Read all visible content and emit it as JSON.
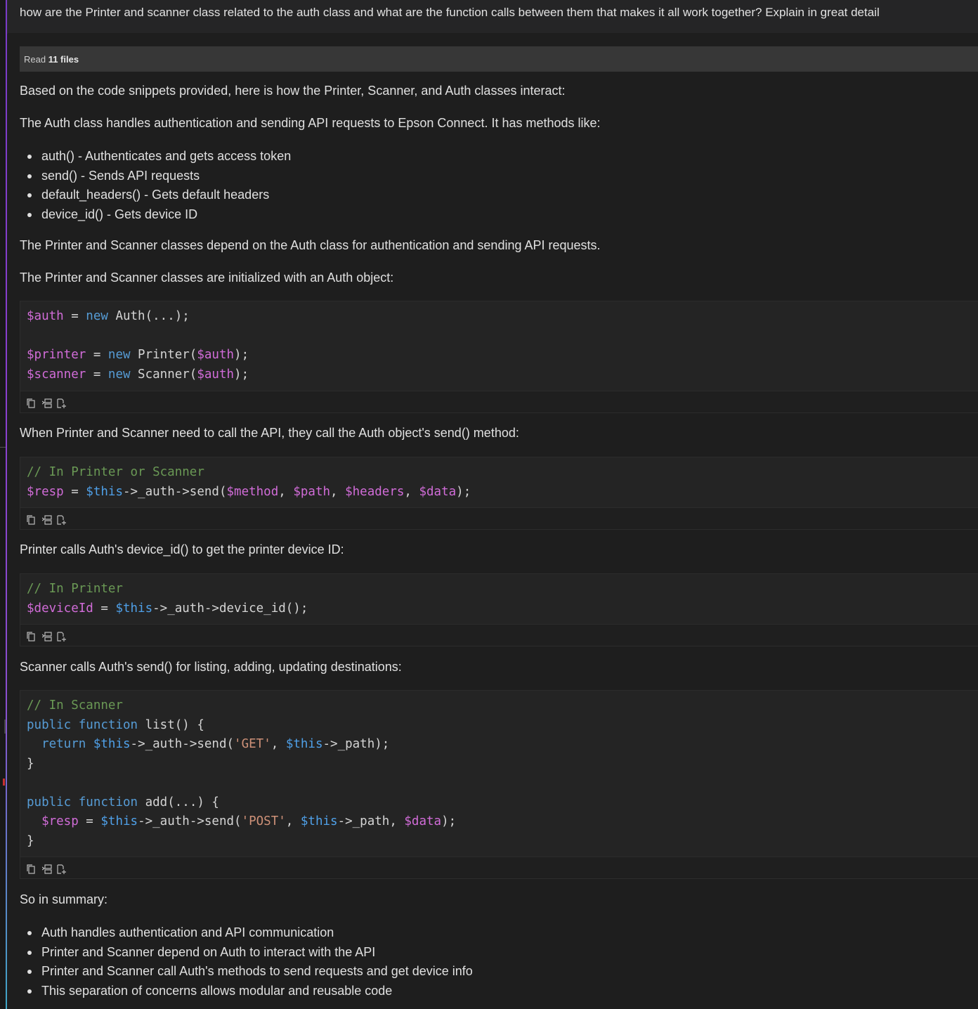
{
  "question": "how are the Printer and scanner class related to the auth class and what are the function calls between them that makes it all work together? Explain in great detail",
  "read_bar": {
    "prefix": "Read",
    "files": "11 files"
  },
  "intro": "Based on the code snippets provided, here is how the Printer, Scanner, and Auth classes interact:",
  "auth_desc": "The Auth class handles authentication and sending API requests to Epson Connect. It has methods like:",
  "auth_methods": [
    "auth() - Authenticates and gets access token",
    "send() - Sends API requests",
    "default_headers() - Gets default headers",
    "device_id() - Gets device ID"
  ],
  "depend_text": "The Printer and Scanner classes depend on the Auth class for authentication and sending API requests.",
  "init_text": "The Printer and Scanner classes are initialized with an Auth object:",
  "send_text": "When Printer and Scanner need to call the API, they call the Auth object's send() method:",
  "device_text": "Printer calls Auth's device_id() to get the printer device ID:",
  "scanner_text": "Scanner calls Auth's send() for listing, adding, updating destinations:",
  "summary_title": "So in summary:",
  "summary_items": [
    "Auth handles authentication and API communication",
    "Printer and Scanner depend on Auth to interact with the API",
    "Printer and Scanner call Auth's methods to send requests and get device info",
    "This separation of concerns allows modular and reusable code"
  ],
  "code_tools": [
    "copy-icon",
    "insert-at-cursor-icon",
    "new-file-icon"
  ]
}
